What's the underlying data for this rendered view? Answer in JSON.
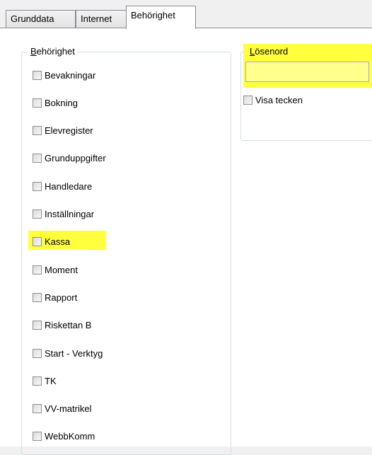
{
  "tabs": [
    {
      "label": "Grunddata",
      "active": false
    },
    {
      "label": "Internet",
      "active": false
    },
    {
      "label": "Behörighet",
      "active": true
    }
  ],
  "permissions": {
    "group_title_first": "B",
    "group_title_rest": "ehörighet",
    "items": [
      {
        "label": "Bevakningar",
        "checked": false
      },
      {
        "label": "Bokning",
        "checked": false
      },
      {
        "label": "Elevregister",
        "checked": false
      },
      {
        "label": "Grunduppgifter",
        "checked": false
      },
      {
        "label": "Handledare",
        "checked": false
      },
      {
        "label": "Inställningar",
        "checked": false
      },
      {
        "label": "Kassa",
        "checked": false,
        "highlighted": true
      },
      {
        "label": "Moment",
        "checked": false
      },
      {
        "label": "Rapport",
        "checked": false
      },
      {
        "label": "Riskettan B",
        "checked": false
      },
      {
        "label": "Start - Verktyg",
        "checked": false
      },
      {
        "label": "TK",
        "checked": false
      },
      {
        "label": "VV-matrikel",
        "checked": false
      },
      {
        "label": "WebbKomm",
        "checked": false
      }
    ]
  },
  "password": {
    "group_title_first": "L",
    "group_title_rest": "ösenord",
    "value": "",
    "show_chars_label": "Visa tecken",
    "show_chars_checked": false
  },
  "colors": {
    "highlight": "#ffff3e",
    "window_bg": "#f0f0f0",
    "page_bg": "#ffffff"
  }
}
